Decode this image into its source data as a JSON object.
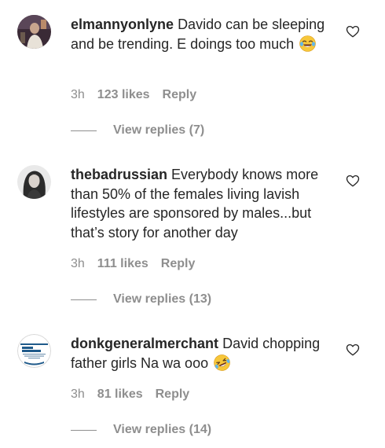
{
  "comments": [
    {
      "username": "elmannyonlyne",
      "text": "Davido can be sleeping and be trending. E doings too much",
      "emoji": "face-with-tears-of-joy",
      "time": "3h",
      "likes": "123 likes",
      "reply_label": "Reply",
      "replies_label": "View replies (7)"
    },
    {
      "username": "thebadrussian",
      "text": "Everybody knows more than 50% of the females living lavish lifestyles are sponsored by males...but that’s story for another day",
      "time": "3h",
      "likes": "111 likes",
      "reply_label": "Reply",
      "replies_label": "View replies (13)"
    },
    {
      "username": "donkgeneralmerchant",
      "text": "David chopping father girls Na wa ooo",
      "emoji": "rolling-on-the-floor-laughing",
      "time": "3h",
      "likes": "81 likes",
      "reply_label": "Reply",
      "replies_label": "View replies (14)"
    }
  ],
  "colors": {
    "text": "#262626",
    "secondary": "#8e8e8e",
    "background": "#ffffff"
  }
}
